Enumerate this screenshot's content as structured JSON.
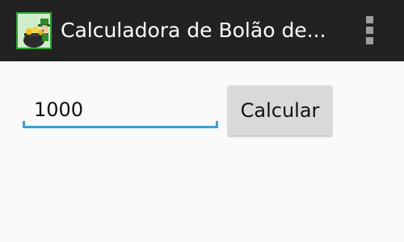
{
  "action_bar": {
    "title": "Calculadora de Bolão de...",
    "app_icon": "leprechaun-pot-icon",
    "menu_icon": "overflow-menu-icon",
    "background_color": "#222222"
  },
  "form": {
    "amount_value": "1000",
    "amount_placeholder": "",
    "accent_color": "#3c9fd4",
    "calculate_label": "Calcular"
  }
}
